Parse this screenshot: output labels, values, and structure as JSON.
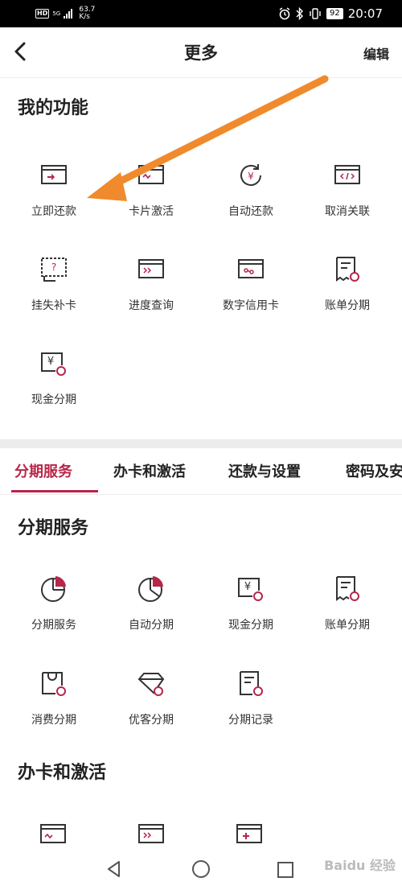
{
  "status_bar": {
    "hd": "HD",
    "network": "5G",
    "speed_value": "63.7",
    "speed_unit": "K/s",
    "battery": "92",
    "time": "20:07"
  },
  "nav": {
    "title": "更多",
    "edit": "编辑"
  },
  "my_functions": {
    "title": "我的功能",
    "items": [
      {
        "label": "立即还款",
        "icon": "card-repay-icon"
      },
      {
        "label": "卡片激活",
        "icon": "card-activate-icon"
      },
      {
        "label": "自动还款",
        "icon": "auto-repay-icon"
      },
      {
        "label": "取消关联",
        "icon": "unlink-icon"
      },
      {
        "label": "挂失补卡",
        "icon": "report-loss-icon"
      },
      {
        "label": "进度查询",
        "icon": "progress-query-icon"
      },
      {
        "label": "数字信用卡",
        "icon": "digital-card-icon"
      },
      {
        "label": "账单分期",
        "icon": "bill-installment-icon"
      },
      {
        "label": "现金分期",
        "icon": "cash-installment-icon"
      }
    ]
  },
  "tabs": [
    {
      "label": "分期服务",
      "active": true
    },
    {
      "label": "办卡和激活",
      "active": false
    },
    {
      "label": "还款与设置",
      "active": false
    },
    {
      "label": "密码及安",
      "active": false
    }
  ],
  "installment": {
    "title": "分期服务",
    "items": [
      {
        "label": "分期服务",
        "icon": "pie-chart-icon"
      },
      {
        "label": "自动分期",
        "icon": "pie-chart-icon"
      },
      {
        "label": "现金分期",
        "icon": "cash-installment-icon"
      },
      {
        "label": "账单分期",
        "icon": "bill-installment-icon"
      },
      {
        "label": "消费分期",
        "icon": "shopping-bag-icon"
      },
      {
        "label": "优客分期",
        "icon": "diamond-icon"
      },
      {
        "label": "分期记录",
        "icon": "record-icon"
      }
    ]
  },
  "card_activation": {
    "title": "办卡和激活"
  },
  "watermark": "Baidu 经验",
  "colors": {
    "accent": "#b8264a",
    "arrow": "#f08a2c",
    "divider": "#ececec"
  }
}
